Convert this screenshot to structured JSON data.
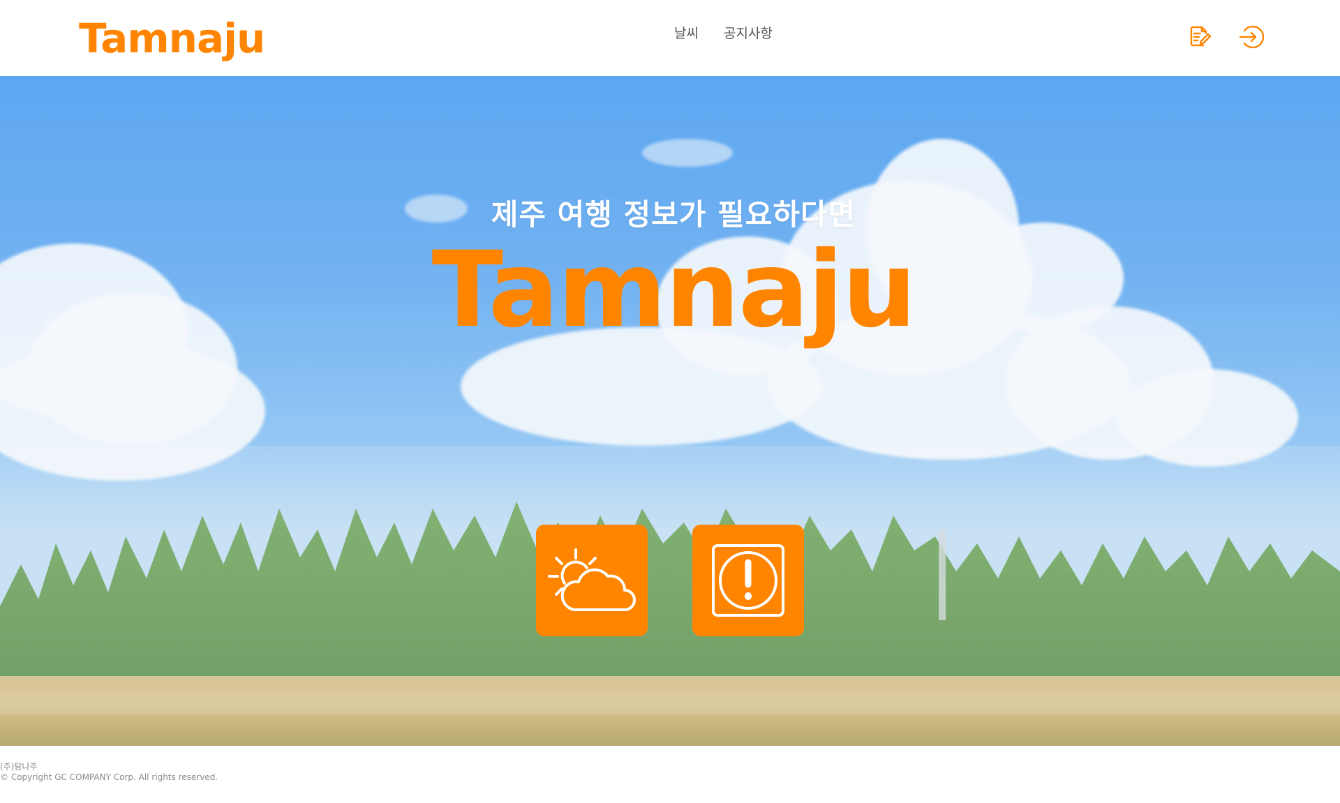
{
  "brand": {
    "name": "Tamnaju",
    "color": "#ff8500"
  },
  "nav": {
    "items": [
      {
        "label": "날씨"
      },
      {
        "label": "공지사항"
      }
    ]
  },
  "header_icons": {
    "write": "edit-note-icon",
    "login": "login-arrow-icon"
  },
  "hero": {
    "subtitle": "제주 여행 정보가 필요하다면",
    "title": "Tamnaju",
    "background": "sky-clouds-forest-photo"
  },
  "tiles": [
    {
      "icon": "partly-cloudy-icon"
    },
    {
      "icon": "alert-notice-icon"
    }
  ],
  "footer": {
    "company": "(주)탐나주",
    "copyright": "© Copyright GC COMPANY Corp. All rights reserved."
  }
}
